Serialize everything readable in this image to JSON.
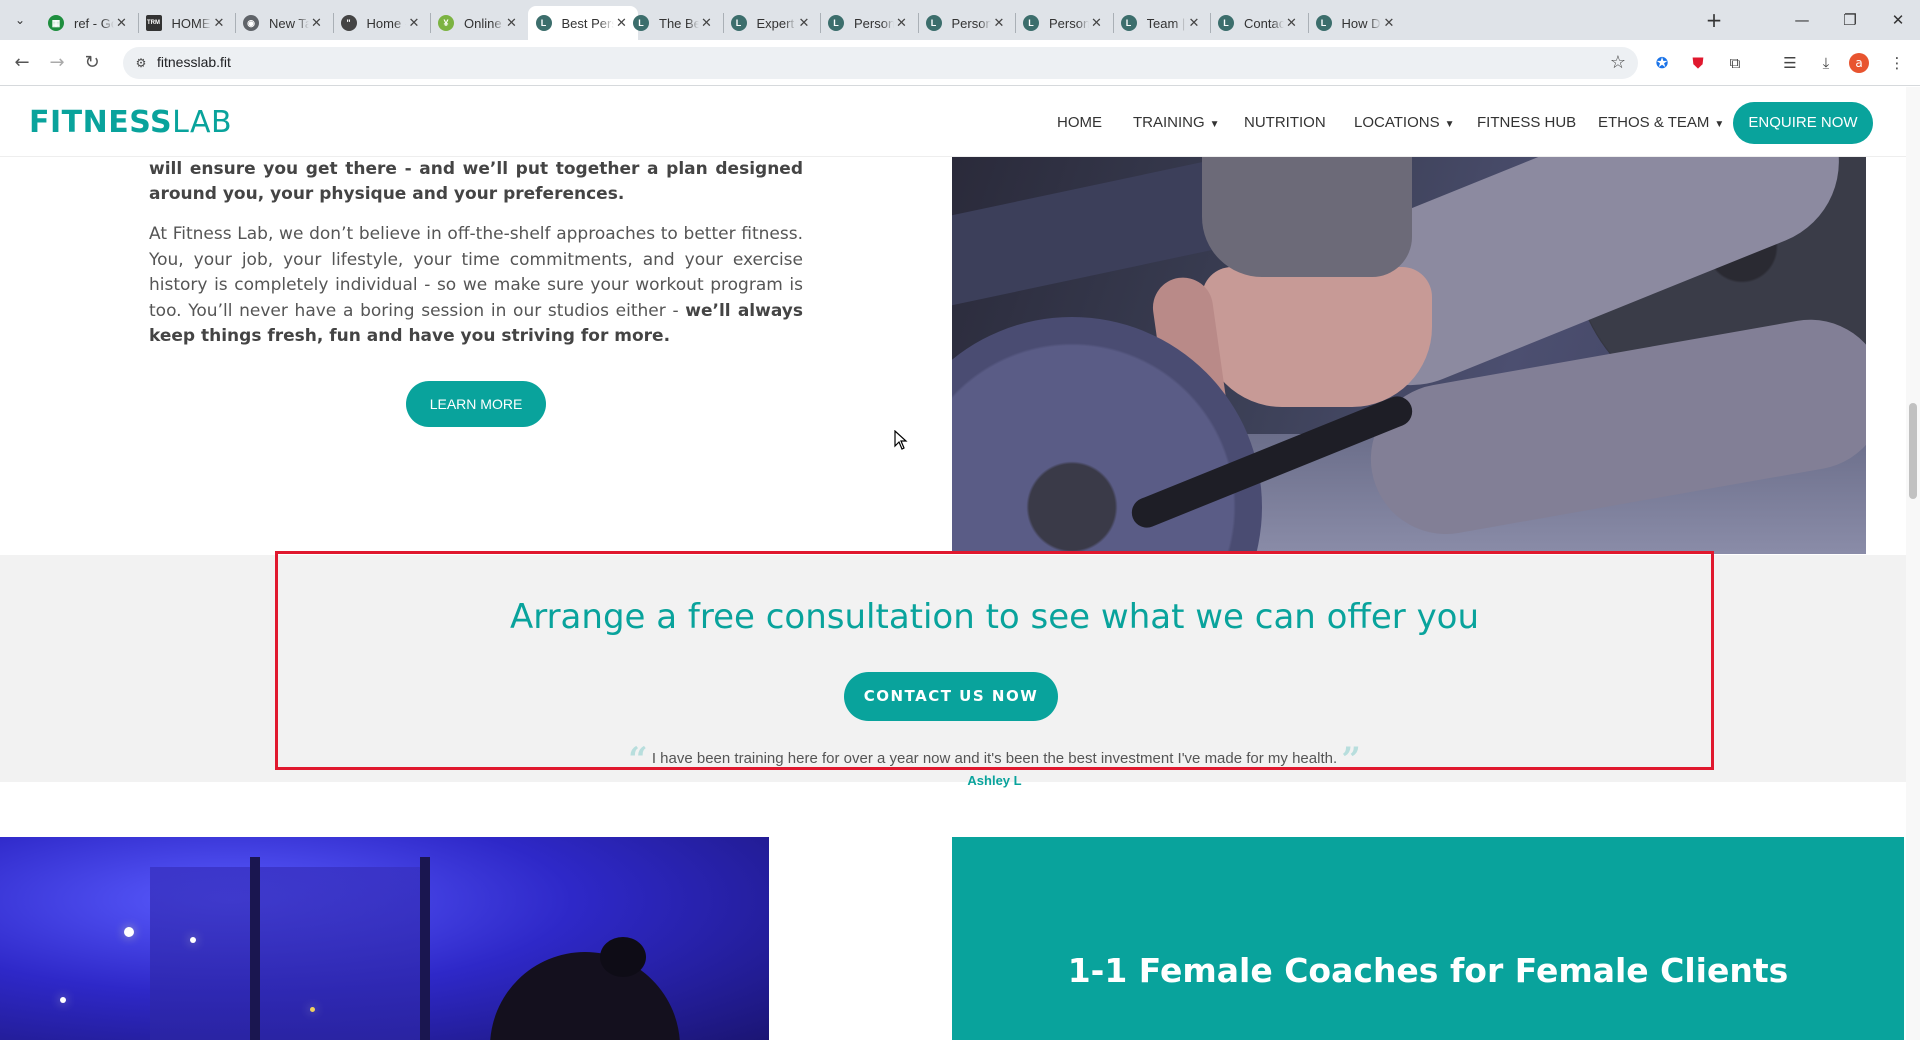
{
  "browser": {
    "tabs": [
      {
        "title": "ref - Goo",
        "favicon": "sheets-icon",
        "color": "#1e8e3e",
        "glyph": "▦"
      },
      {
        "title": "HOME -",
        "favicon": "trm-icon",
        "color": "#333333",
        "glyph": "TRM"
      },
      {
        "title": "New Tab",
        "favicon": "chrome-icon",
        "color": "#5f6368",
        "glyph": "◉"
      },
      {
        "title": "Home - I",
        "favicon": "site-icon",
        "color": "#444444",
        "glyph": "\""
      },
      {
        "title": "Online P",
        "favicon": "figure-icon",
        "color": "#7cb342",
        "glyph": "¥"
      },
      {
        "title": "Best Pers",
        "favicon": "fitnesslab-icon",
        "color": "#3c6e6c",
        "glyph": "L",
        "active": true
      },
      {
        "title": "The Best",
        "favicon": "fitnesslab-icon",
        "color": "#3c6e6c",
        "glyph": "L"
      },
      {
        "title": "Expert Sp",
        "favicon": "fitnesslab-icon",
        "color": "#3c6e6c",
        "glyph": "L"
      },
      {
        "title": "Personal",
        "favicon": "fitnesslab-icon",
        "color": "#3c6e6c",
        "glyph": "L"
      },
      {
        "title": "Personal",
        "favicon": "fitnesslab-icon",
        "color": "#3c6e6c",
        "glyph": "L"
      },
      {
        "title": "Personal",
        "favicon": "fitnesslab-icon",
        "color": "#3c6e6c",
        "glyph": "L"
      },
      {
        "title": "Team | Fi",
        "favicon": "fitnesslab-icon",
        "color": "#3c6e6c",
        "glyph": "L"
      },
      {
        "title": "Contact",
        "favicon": "fitnesslab-icon",
        "color": "#3c6e6c",
        "glyph": "L"
      },
      {
        "title": "How Do",
        "favicon": "fitnesslab-icon",
        "color": "#3c6e6c",
        "glyph": "L"
      }
    ],
    "url": "fitnesslab.fit",
    "profile_initial": "a"
  },
  "site": {
    "logo_bold": "FITNESS",
    "logo_light": "LAB",
    "nav": {
      "home": "HOME",
      "training": "TRAINING",
      "nutrition": "NUTRITION",
      "locations": "LOCATIONS",
      "fitness_hub": "FITNESS HUB",
      "ethos_team": "ETHOS & TEAM"
    },
    "enquire_label": "ENQUIRE NOW"
  },
  "intro": {
    "bold_text": "will ensure you get there - and we’ll put together a plan designed around you, your physique and your preferences.",
    "body_text": "At Fitness Lab, we don’t believe in off-the-shelf approaches to better fitness. You, your job, your lifestyle, your time commitments, and your exercise history is completely individual - so we make sure your workout program is too. You’ll never have a boring session in our studios either - ",
    "body_bold": "we’ll always keep things fresh, fun and have you striving for more.",
    "learn_more_label": "LEARN MORE"
  },
  "cta": {
    "title": "Arrange a free consultation to see what we can offer you",
    "button_label": "CONTACT US NOW",
    "testimonial": "I have been training here for over a year now and it's been the best investment I've made for my health.",
    "author": "Ashley L"
  },
  "female": {
    "title": "1-1 Female Coaches for Female Clients"
  },
  "colors": {
    "brand": "#09a39c",
    "highlight_frame": "#e0182e"
  }
}
